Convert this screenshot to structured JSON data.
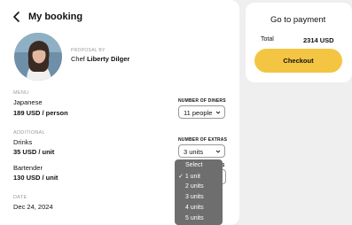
{
  "booking": {
    "title": "My booking",
    "proposal_label": "PROPOSAL BY",
    "chef_prefix": "Chef",
    "chef_name": "Liberty Dilger",
    "menu_label": "MENU",
    "menu_name": "Japanese",
    "menu_price": "189 USD / person",
    "diners_label": "NUMBER OF DINERS",
    "diners_value": "11 people",
    "additional_label": "ADDITIONAL",
    "extra1_name": "Drinks",
    "extra1_price": "35 USD / unit",
    "extras_label": "NUMBER OF EXTRAS",
    "extras_value": "3 units",
    "extras_label2_fragment": "S",
    "extra2_name": "Bartender",
    "extra2_price": "130 USD / unit",
    "date_label": "DATE",
    "date_value": "Dec 24, 2024"
  },
  "dropdown": {
    "options": [
      "Select",
      "1 unit",
      "2 units",
      "3 units",
      "4 units",
      "5 units"
    ],
    "selected_mark": "✓",
    "selected_index": 1
  },
  "payment": {
    "title": "Go to payment",
    "total_label": "Total",
    "total_value": "2314 USD",
    "checkout_label": "Checkout"
  },
  "colors": {
    "accent": "#f4c542",
    "dropdown_bg": "#6e6e6e",
    "muted": "#9a9a9a"
  }
}
